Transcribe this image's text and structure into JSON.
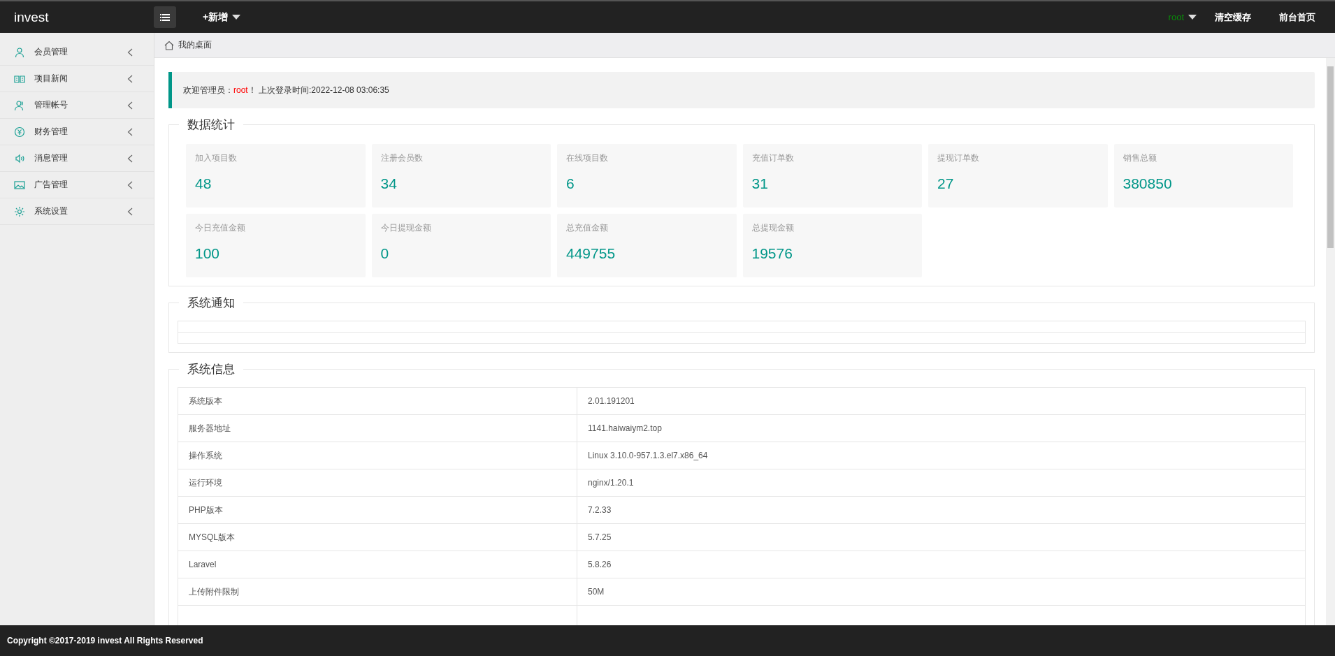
{
  "header": {
    "logo": "invest",
    "add_menu": "+新增",
    "user": "root",
    "links": [
      "清空缓存",
      "前台首页"
    ]
  },
  "sidebar": {
    "items": [
      {
        "label": "会员管理"
      },
      {
        "label": "项目新闻"
      },
      {
        "label": "管理帐号"
      },
      {
        "label": "财务管理"
      },
      {
        "label": "消息管理"
      },
      {
        "label": "广告管理"
      },
      {
        "label": "系统设置"
      }
    ]
  },
  "breadcrumb": "我的桌面",
  "welcome": {
    "prefix": "欢迎管理员：",
    "user": "root",
    "suffix": "！ 上次登录时间:2022-12-08 03:06:35"
  },
  "stats": {
    "title": "数据统计",
    "cards": [
      {
        "label": "加入项目数",
        "value": "48"
      },
      {
        "label": "注册会员数",
        "value": "34"
      },
      {
        "label": "在线项目数",
        "value": "6"
      },
      {
        "label": "充值订单数",
        "value": "31"
      },
      {
        "label": "提现订单数",
        "value": "27"
      },
      {
        "label": "销售总额",
        "value": "380850"
      },
      {
        "label": "今日充值金额",
        "value": "100"
      },
      {
        "label": "今日提现金额",
        "value": "0"
      },
      {
        "label": "总充值金额",
        "value": "449755"
      },
      {
        "label": "总提现金额",
        "value": "19576"
      }
    ]
  },
  "notice": {
    "title": "系统通知"
  },
  "info": {
    "title": "系统信息",
    "rows": [
      {
        "name": "系统版本",
        "value": "2.01.191201"
      },
      {
        "name": "服务器地址",
        "value": "1141.haiwaiym2.top"
      },
      {
        "name": "操作系统",
        "value": "Linux 3.10.0-957.1.3.el7.x86_64"
      },
      {
        "name": "运行环境",
        "value": "nginx/1.20.1"
      },
      {
        "name": "PHP版本",
        "value": "7.2.33"
      },
      {
        "name": "MYSQL版本",
        "value": "5.7.25"
      },
      {
        "name": "Laravel",
        "value": "5.8.26"
      },
      {
        "name": "上传附件限制",
        "value": "50M"
      }
    ]
  },
  "footer": "Copyright ©2017-2019 invest All Rights Reserved"
}
